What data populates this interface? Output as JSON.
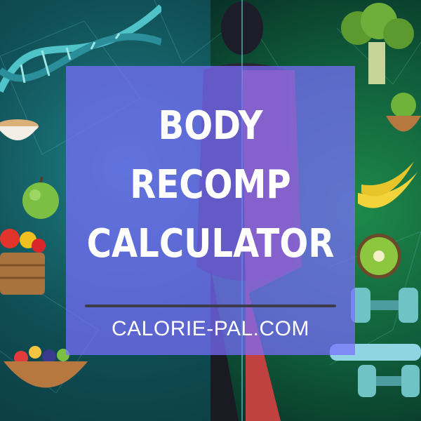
{
  "banner": {
    "title_lines": [
      "BODY",
      "RECOMP",
      "CALCULATOR"
    ],
    "website": "CALORIE-PAL.COM"
  },
  "decorations": {
    "left_side": [
      "dna-helix",
      "cereal-bowl",
      "apple",
      "vegetable-basket",
      "fruit-bowl"
    ],
    "center": [
      "human-body-muscles"
    ],
    "right_side": [
      "broccoli",
      "salad-bowl",
      "bananas",
      "kiwi",
      "dumbbells",
      "resistance-band"
    ]
  },
  "colors": {
    "overlay": "#7a6eff",
    "title_text": "#ffffff",
    "divider": "#3c3c4a"
  }
}
